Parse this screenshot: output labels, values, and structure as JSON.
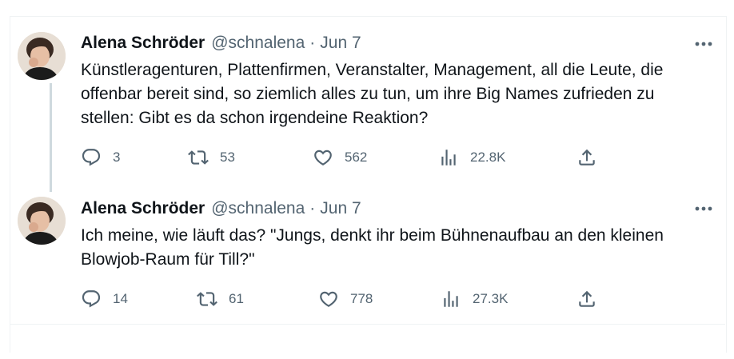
{
  "tweets": [
    {
      "author_name": "Alena Schröder",
      "handle": "@schnalena",
      "separator": "·",
      "date": "Jun 7",
      "text": "Künstleragenturen, Plattenfirmen, Veranstalter, Management, all die Leute, die offenbar bereit sind, so ziemlich alles zu tun, um ihre Big Names zufrieden zu stellen: Gibt es da schon irgendeine Reaktion?",
      "replies": "3",
      "retweets": "53",
      "likes": "562",
      "views": "22.8K"
    },
    {
      "author_name": "Alena Schröder",
      "handle": "@schnalena",
      "separator": "·",
      "date": "Jun 7",
      "text": "Ich meine, wie läuft das? \"Jungs, denkt ihr beim Bühnenaufbau an den kleinen Blowjob-Raum für Till?\"",
      "replies": "14",
      "retweets": "61",
      "likes": "778",
      "views": "27.3K"
    }
  ],
  "icons": {
    "reply": "reply-icon",
    "retweet": "retweet-icon",
    "like": "heart-icon",
    "views": "views-icon",
    "share": "share-icon",
    "more": "more-icon"
  },
  "colors": {
    "text": "#0f1419",
    "secondary": "#536471",
    "thread_line": "#cfd9de"
  }
}
